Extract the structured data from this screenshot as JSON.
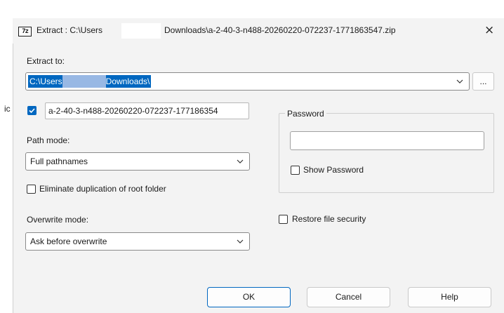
{
  "window": {
    "title_part1": "Extract : C:\\Users",
    "title_part2": "Downloads\\a-2-40-3-n488-20260220-072237-1771863547.zip",
    "app_icon_text": "7z",
    "close_glyph": "×"
  },
  "background_fragment": "ic",
  "extract_to": {
    "label": "Extract to:",
    "path_start": "C:\\Users",
    "path_end": "Downloads\\",
    "browse_label": "..."
  },
  "subfolder": {
    "checked": true,
    "value": "a-2-40-3-n488-20260220-072237-177186354"
  },
  "path_mode": {
    "label": "Path mode:",
    "value": "Full pathnames"
  },
  "eliminate_duplication": {
    "checked": false,
    "label": "Eliminate duplication of root folder"
  },
  "overwrite_mode": {
    "label": "Overwrite mode:",
    "value": "Ask before overwrite"
  },
  "password": {
    "group_label": "Password",
    "value": "",
    "show_label": "Show Password",
    "show_checked": false
  },
  "restore_security": {
    "checked": false,
    "label": "Restore file security"
  },
  "buttons": {
    "ok": "OK",
    "cancel": "Cancel",
    "help": "Help"
  },
  "colors": {
    "accent": "#0067c0",
    "dialog_bg": "#f3f3f3",
    "redaction": "#98b8e4"
  }
}
